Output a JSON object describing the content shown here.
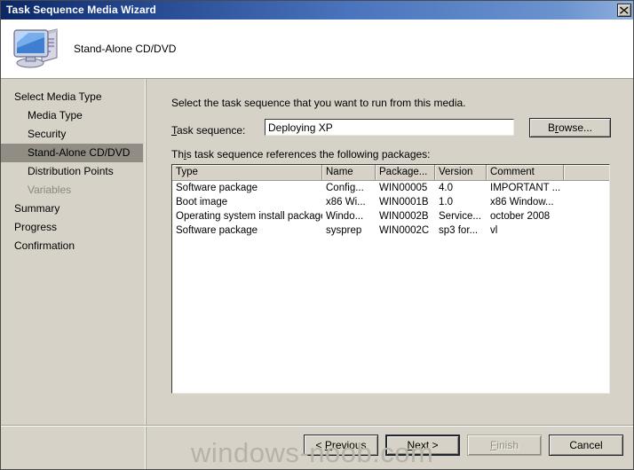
{
  "window": {
    "title": "Task Sequence Media Wizard",
    "close_icon": "close-icon"
  },
  "header": {
    "title": "Stand-Alone CD/DVD",
    "icon": "computer-icon"
  },
  "sidebar": {
    "items": [
      {
        "label": "Select Media Type",
        "level": 0,
        "state": "normal"
      },
      {
        "label": "Media Type",
        "level": 1,
        "state": "normal"
      },
      {
        "label": "Security",
        "level": 1,
        "state": "normal"
      },
      {
        "label": "Stand-Alone CD/DVD",
        "level": 1,
        "state": "selected"
      },
      {
        "label": "Distribution Points",
        "level": 1,
        "state": "normal"
      },
      {
        "label": "Variables",
        "level": 1,
        "state": "disabled"
      },
      {
        "label": "Summary",
        "level": 0,
        "state": "normal"
      },
      {
        "label": "Progress",
        "level": 0,
        "state": "normal"
      },
      {
        "label": "Confirmation",
        "level": 0,
        "state": "normal"
      }
    ]
  },
  "main": {
    "instruction": "Select the task sequence that you want to run from this media.",
    "task_sequence_label": "Task sequence:",
    "task_sequence_value": "Deploying XP",
    "browse_label": "Browse...",
    "packages_label": "This task sequence references the following packages:",
    "table": {
      "columns": [
        "Type",
        "Name",
        "Package...",
        "Version",
        "Comment",
        ""
      ],
      "rows": [
        [
          "Software package",
          "Config...",
          "WIN00005",
          "4.0",
          "IMPORTANT ...",
          ""
        ],
        [
          "Boot image",
          "x86 Wi...",
          "WIN0001B",
          "1.0",
          "x86 Window...",
          ""
        ],
        [
          "Operating system install package",
          "Windo...",
          "WIN0002B",
          "Service...",
          "october 2008",
          ""
        ],
        [
          "Software package",
          "sysprep",
          "WIN0002C",
          "sp3 for...",
          "vl",
          ""
        ]
      ]
    }
  },
  "footer": {
    "previous_label": "< Previous",
    "next_label": "Next >",
    "finish_label": "Finish",
    "cancel_label": "Cancel"
  },
  "watermark": {
    "text": "windows-noob.com"
  },
  "colors": {
    "title_start": "#0b2764",
    "title_end": "#8fb0dd",
    "dialog_face": "#d6d2c8",
    "selected_nav": "#918d85",
    "field_bg": "#ffffff",
    "watermark": "#b6b2a8"
  }
}
